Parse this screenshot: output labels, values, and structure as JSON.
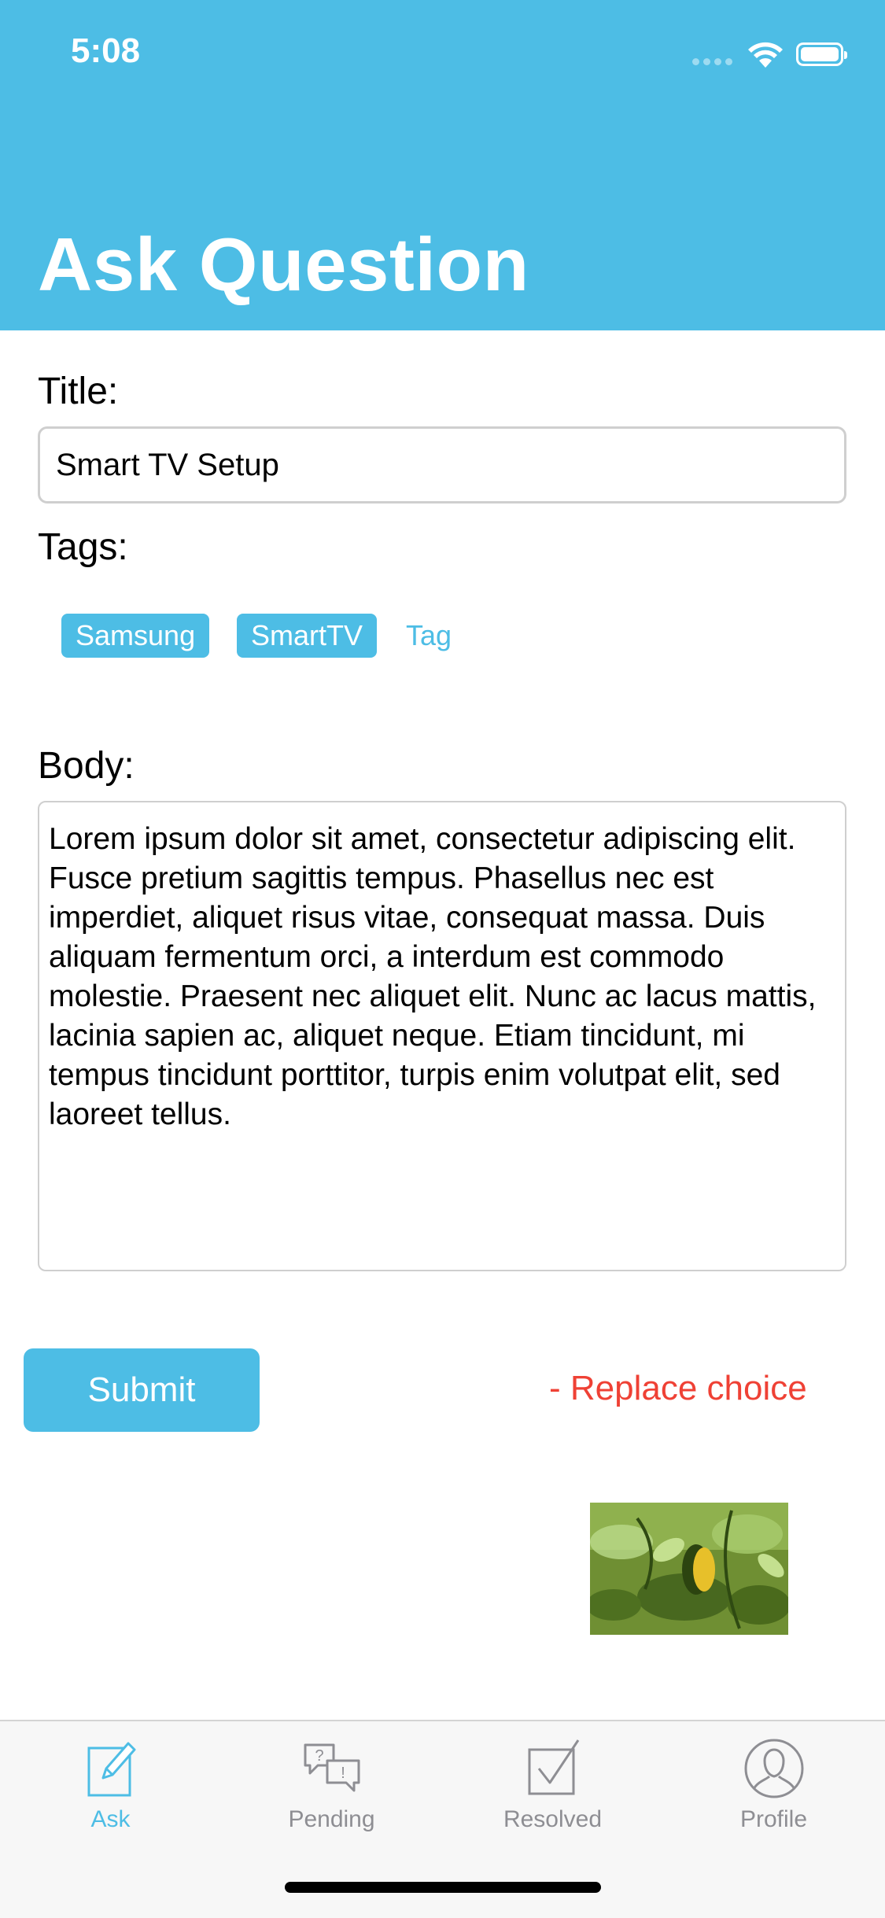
{
  "status_bar": {
    "time": "5:08"
  },
  "header": {
    "title": "Ask Question"
  },
  "form": {
    "title_label": "Title:",
    "title_value": "Smart TV Setup",
    "tags_label": "Tags:",
    "tags": [
      "Samsung",
      "SmartTV"
    ],
    "tag_placeholder": "Tag",
    "body_label": "Body:",
    "body_text": "Lorem ipsum dolor sit amet, consectetur adipiscing elit. Fusce pretium sagittis tempus. Phasellus nec est imperdiet, aliquet risus vitae, consequat massa. Duis aliquam fermentum orci, a interdum est commodo molestie. Praesent nec aliquet elit. Nunc ac lacus mattis, lacinia sapien ac, aliquet neque. Etiam tincidunt, mi tempus tincidunt porttitor, turpis enim volutpat elit, sed laoreet tellus.",
    "submit_label": "Submit",
    "replace_label": "- Replace choice"
  },
  "tabs": [
    {
      "label": "Ask",
      "icon": "compose-icon",
      "active": true
    },
    {
      "label": "Pending",
      "icon": "chat-question-icon",
      "active": false
    },
    {
      "label": "Resolved",
      "icon": "checkbox-icon",
      "active": false
    },
    {
      "label": "Profile",
      "icon": "person-icon",
      "active": false
    }
  ],
  "colors": {
    "accent": "#4dbde5",
    "danger": "#ef4135",
    "inactive": "#8e8e93"
  }
}
